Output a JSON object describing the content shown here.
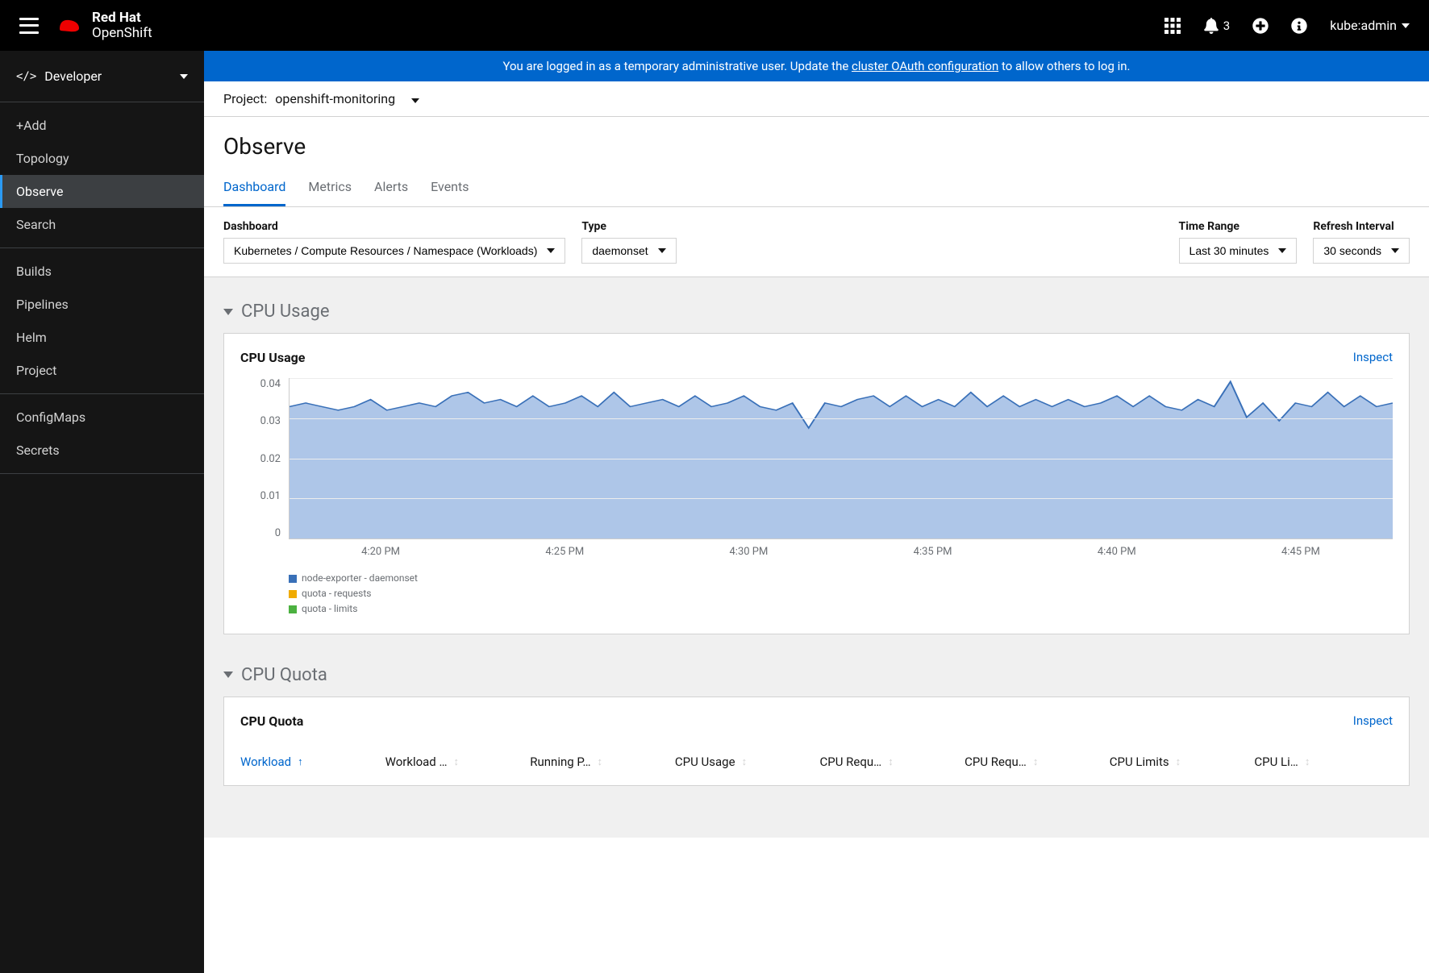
{
  "masthead": {
    "brand_line1": "Red Hat",
    "brand_line2": "OpenShift",
    "notifications_count": "3",
    "user": "kube:admin"
  },
  "sidebar": {
    "perspective": "Developer",
    "sections": [
      {
        "items": [
          "+Add",
          "Topology",
          "Observe",
          "Search"
        ],
        "active_index": 2
      },
      {
        "items": [
          "Builds",
          "Pipelines",
          "Helm",
          "Project"
        ]
      },
      {
        "items": [
          "ConfigMaps",
          "Secrets"
        ]
      }
    ]
  },
  "banner": {
    "prefix": "You are logged in as a temporary administrative user. Update the ",
    "link": "cluster OAuth configuration",
    "suffix": " to allow others to log in."
  },
  "project_bar": {
    "label": "Project:",
    "value": "openshift-monitoring"
  },
  "page": {
    "title": "Observe",
    "tabs": [
      "Dashboard",
      "Metrics",
      "Alerts",
      "Events"
    ],
    "active_tab": 0
  },
  "toolbar": {
    "dashboard": {
      "label": "Dashboard",
      "value": "Kubernetes / Compute Resources / Namespace (Workloads)"
    },
    "type": {
      "label": "Type",
      "value": "daemonset"
    },
    "time_range": {
      "label": "Time Range",
      "value": "Last 30 minutes"
    },
    "refresh": {
      "label": "Refresh Interval",
      "value": "30 seconds"
    }
  },
  "sections": {
    "cpu_usage": {
      "title": "CPU Usage",
      "card_title": "CPU Usage",
      "inspect": "Inspect"
    },
    "cpu_quota": {
      "title": "CPU Quota",
      "card_title": "CPU Quota",
      "inspect": "Inspect",
      "columns": [
        "Workload",
        "Workload …",
        "Running P…",
        "CPU Usage",
        "CPU Requ…",
        "CPU Requ…",
        "CPU Limits",
        "CPU Li…"
      ],
      "sorted_col": 0
    }
  },
  "chart_data": {
    "type": "area",
    "title": "CPU Usage",
    "ylabel": "",
    "ylim": [
      0,
      0.045
    ],
    "y_ticks": [
      "0.04",
      "0.03",
      "0.02",
      "0.01",
      "0"
    ],
    "x_ticks": [
      "4:20 PM",
      "4:25 PM",
      "4:30 PM",
      "4:35 PM",
      "4:40 PM",
      "4:45 PM"
    ],
    "series": [
      {
        "name": "node-exporter - daemonset",
        "color": "#3970b8",
        "fill": "#aec6e8",
        "values": [
          0.037,
          0.038,
          0.037,
          0.036,
          0.037,
          0.039,
          0.036,
          0.037,
          0.038,
          0.037,
          0.04,
          0.041,
          0.038,
          0.039,
          0.037,
          0.04,
          0.037,
          0.038,
          0.04,
          0.037,
          0.041,
          0.037,
          0.038,
          0.039,
          0.037,
          0.04,
          0.037,
          0.038,
          0.04,
          0.037,
          0.036,
          0.038,
          0.031,
          0.038,
          0.037,
          0.039,
          0.04,
          0.037,
          0.04,
          0.037,
          0.039,
          0.037,
          0.041,
          0.037,
          0.04,
          0.037,
          0.039,
          0.037,
          0.039,
          0.037,
          0.038,
          0.04,
          0.037,
          0.04,
          0.037,
          0.036,
          0.039,
          0.037,
          0.044,
          0.034,
          0.038,
          0.033,
          0.038,
          0.037,
          0.041,
          0.037,
          0.04,
          0.037,
          0.038
        ]
      },
      {
        "name": "quota - requests",
        "color": "#f0ab00",
        "values": []
      },
      {
        "name": "quota - limits",
        "color": "#4cb140",
        "values": []
      }
    ]
  }
}
